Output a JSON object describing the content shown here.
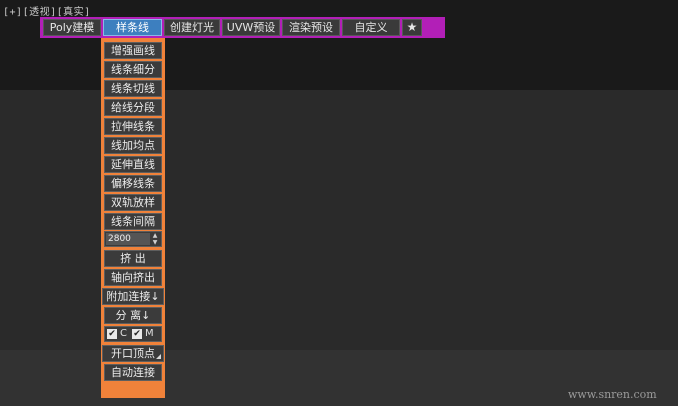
{
  "viewport": {
    "label_plus": "[+]",
    "label_view": "[透视]",
    "label_shading": "[真实]"
  },
  "toolbar": {
    "tabs": [
      "Poly建模",
      "样条线",
      "创建灯光",
      "UVW预设",
      "渲染预设",
      "自定义"
    ],
    "active_tab": "样条线",
    "star_icon": "★",
    "background_color": "#b21fb7",
    "active_color": "#3d7fbf"
  },
  "spline_menu": {
    "panel_color": "#f0823a",
    "items": [
      "增强画线",
      "线条细分",
      "线条切线",
      "给线分段",
      "拉伸线条",
      "线加均点",
      "延伸直线",
      "偏移线条",
      "双轨放样",
      "线条间隔"
    ],
    "spinner_value": "2800",
    "extrude_label": "挤 出",
    "axis_extrude_label": "轴向挤出",
    "attach_label": "附加连接↓",
    "detach_label": "分 离↓",
    "check_c_label": "C",
    "check_m_label": "M",
    "check_c_checked": true,
    "check_m_checked": true,
    "open_vertex_label": "开口顶点",
    "auto_connect_label": "自动连接"
  },
  "watermark": "www.snren.com"
}
